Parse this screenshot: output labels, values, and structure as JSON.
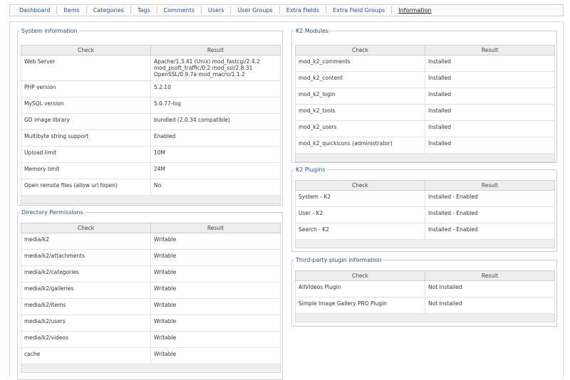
{
  "tabs": [
    {
      "label": "Dashboard",
      "active": false
    },
    {
      "label": "Items",
      "active": false
    },
    {
      "label": "Categories",
      "active": false
    },
    {
      "label": "Tags",
      "active": false
    },
    {
      "label": "Comments",
      "active": false
    },
    {
      "label": "Users",
      "active": false
    },
    {
      "label": "User Groups",
      "active": false
    },
    {
      "label": "Extra Fields",
      "active": false
    },
    {
      "label": "Extra Field Groups",
      "active": false
    },
    {
      "label": "Information",
      "active": true
    }
  ],
  "system_info": {
    "title": "System information",
    "headers": {
      "check": "Check",
      "result": "Result"
    },
    "rows": [
      {
        "check": "Web Server",
        "result": "Apache/1.3.41 (Unix) mod_fastcgi/2.4.2 mod_psoft_traffic/0.2 mod_ssl/2.8.31 OpenSSL/0.9.7a mod_macro/1.1.2"
      },
      {
        "check": "PHP version",
        "result": "5.2.10"
      },
      {
        "check": "MySQL version",
        "result": "5.0.77-log"
      },
      {
        "check": "GD image library",
        "result": "bundled (2.0.34 compatible)"
      },
      {
        "check": "Multibyte string support",
        "result": "Enabled"
      },
      {
        "check": "Upload limit",
        "result": "10M"
      },
      {
        "check": "Memory limit",
        "result": "24M"
      },
      {
        "check": "Open remote files (allow url fopen)",
        "result": "No"
      }
    ]
  },
  "dir_perms": {
    "title": "Directory Permissions",
    "headers": {
      "check": "Check",
      "result": "Result"
    },
    "rows": [
      {
        "check": "media/k2",
        "result": "Writable"
      },
      {
        "check": "media/k2/attachments",
        "result": "Writable"
      },
      {
        "check": "media/k2/categories",
        "result": "Writable"
      },
      {
        "check": "media/k2/galleries",
        "result": "Writable"
      },
      {
        "check": "media/k2/items",
        "result": "Writable"
      },
      {
        "check": "media/k2/users",
        "result": "Writable"
      },
      {
        "check": "media/k2/videos",
        "result": "Writable"
      },
      {
        "check": "cache",
        "result": "Writable"
      }
    ]
  },
  "k2_modules": {
    "title": "K2 Modules",
    "headers": {
      "check": "Check",
      "result": "Result"
    },
    "rows": [
      {
        "check": "mod_k2_comments",
        "result": "Installed"
      },
      {
        "check": "mod_k2_content",
        "result": "Installed"
      },
      {
        "check": "mod_k2_login",
        "result": "Installed"
      },
      {
        "check": "mod_k2_tools",
        "result": "Installed"
      },
      {
        "check": "mod_k2_users",
        "result": "Installed"
      },
      {
        "check": "mod_k2_quickicons (administrator)",
        "result": "Installed"
      }
    ]
  },
  "k2_plugins": {
    "title": "K2 Plugins",
    "headers": {
      "check": "Check",
      "result": "Result"
    },
    "rows": [
      {
        "check": "System - K2",
        "result": "Installed - Enabled"
      },
      {
        "check": "User - K2",
        "result": "Installed - Enabled"
      },
      {
        "check": "Search - K2",
        "result": "Installed - Enabled"
      }
    ]
  },
  "third_party": {
    "title": "Third-party plugin information",
    "headers": {
      "check": "Check",
      "result": "Result"
    },
    "rows": [
      {
        "check": "AllVideos Plugin",
        "result": "Not Installed"
      },
      {
        "check": "Simple Image Gallery PRO Plugin",
        "result": "Not Installed"
      }
    ]
  }
}
